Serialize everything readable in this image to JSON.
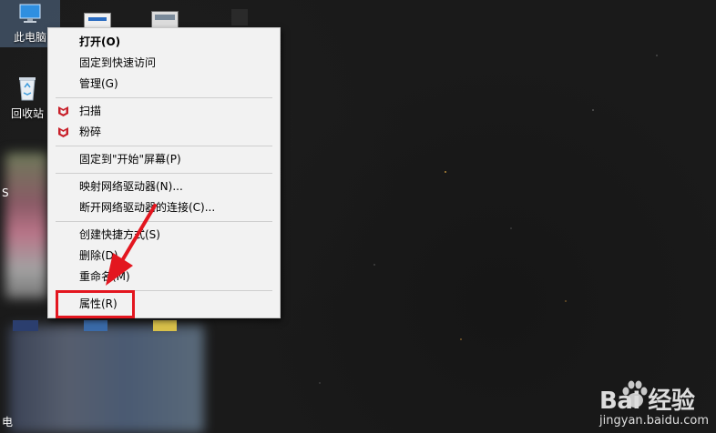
{
  "desktop": {
    "icons": [
      {
        "label": "此电脑"
      },
      {
        "label": "回收站"
      }
    ],
    "partial_letters": {
      "s": "S",
      "dian": "电"
    }
  },
  "context_menu": {
    "items": [
      {
        "label": "打开(O)",
        "bold": true
      },
      {
        "label": "固定到快速访问"
      },
      {
        "label": "管理(G)"
      },
      {
        "label": "扫描",
        "icon": "mcafee-icon"
      },
      {
        "label": "粉碎",
        "icon": "mcafee-icon"
      },
      {
        "label": "固定到\"开始\"屏幕(P)"
      },
      {
        "label": "映射网络驱动器(N)..."
      },
      {
        "label": "断开网络驱动器的连接(C)..."
      },
      {
        "label": "创建快捷方式(S)"
      },
      {
        "label": "删除(D)"
      },
      {
        "label": "重命名(M)"
      },
      {
        "label": "属性(R)"
      }
    ]
  },
  "annotations": {
    "highlight_color": "#e3161f",
    "arrow_color": "#e3161f"
  },
  "watermark": {
    "logo": "Bai 经验",
    "url": "jingyan.baidu.com"
  }
}
